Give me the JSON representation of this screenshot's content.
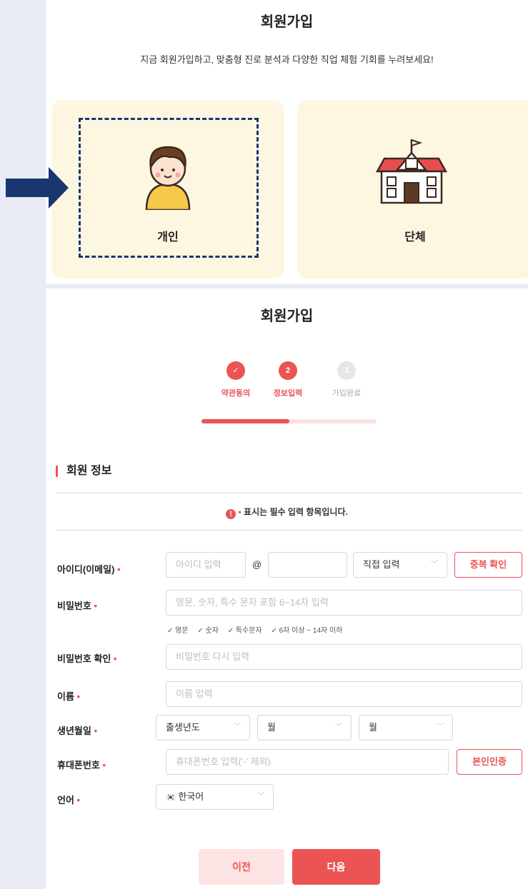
{
  "top": {
    "title": "회원가입",
    "subtitle": "지금 회원가입하고, 맞춤형 진로 분석과 다양한 직업 체험 기회를 누려보세요!",
    "cards": [
      {
        "label": "개인",
        "icon": "child-avatar-icon"
      },
      {
        "label": "단체",
        "icon": "school-building-icon"
      }
    ]
  },
  "form": {
    "title": "회원가입",
    "steps": [
      {
        "label": "약관동의",
        "mark": "✓",
        "state": "done"
      },
      {
        "label": "정보입력",
        "mark": "2",
        "state": "active"
      },
      {
        "label": "가입완료",
        "mark": "3",
        "state": "todo"
      }
    ],
    "progress_fraction": 0.5,
    "section_title": "회원 정보",
    "notice_mark": "!",
    "notice_dot": "•",
    "notice_text": "표시는 필수 입력 항목입니다.",
    "fields": {
      "id": {
        "label": "아이디(이메일)",
        "placeholder": "아이디 입력",
        "at": "@",
        "domain_value": "",
        "domain_select": "직접 입력",
        "check_button": "중복 확인"
      },
      "password": {
        "label": "비밀번호",
        "placeholder": "영문, 숫자, 특수 문자 포함 6~14자 입력",
        "rules": [
          "✓ 영문",
          "✓ 숫자",
          "✓ 특수문자",
          "✓ 6자 이상 ~ 14자 이하"
        ]
      },
      "password_confirm": {
        "label": "비밀번호 확인",
        "placeholder": "비밀번호 다시 입력"
      },
      "name": {
        "label": "이름",
        "placeholder": "이름 입력"
      },
      "birth": {
        "label": "생년월일",
        "year": "출생년도",
        "month": "월",
        "day": "월"
      },
      "phone": {
        "label": "휴대폰번호",
        "placeholder": "휴대폰번호 입력('-' 제외)",
        "verify_button": "본인인증"
      },
      "language": {
        "label": "언어",
        "flag": "🇰🇷",
        "value": "한국어"
      }
    },
    "required_mark": "•",
    "buttons": {
      "prev": "이전",
      "next": "다음"
    }
  },
  "colors": {
    "accent": "#ea5455",
    "card_bg": "#fdf7e2",
    "highlight": "#1a3670"
  }
}
